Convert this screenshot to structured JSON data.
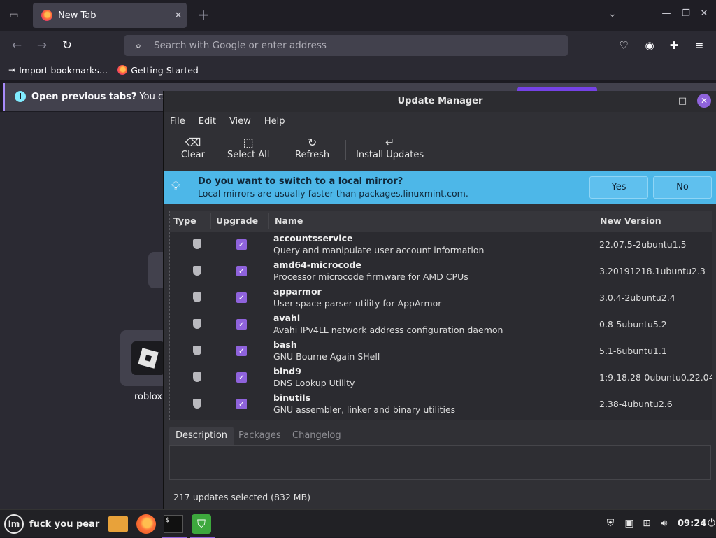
{
  "firefox": {
    "tab_title": "New Tab",
    "tab_close": "✕",
    "new_tab": "+",
    "url_placeholder": "Search with Google or enter address",
    "bookmarks": [
      {
        "label": "Import bookmarks…"
      },
      {
        "label": "Getting Started"
      }
    ],
    "notification": {
      "bold": "Open previous tabs?",
      "text": "You can re"
    },
    "shortcut_label": "roblox"
  },
  "update_manager": {
    "title": "Update Manager",
    "menu": [
      "File",
      "Edit",
      "View",
      "Help"
    ],
    "toolbar": {
      "clear": "Clear",
      "select_all": "Select All",
      "refresh": "Refresh",
      "install": "Install Updates"
    },
    "infobar": {
      "question": "Do you want to switch to a local mirror?",
      "subtext": "Local mirrors are usually faster than packages.linuxmint.com.",
      "yes": "Yes",
      "no": "No"
    },
    "columns": [
      "Type",
      "Upgrade",
      "Name",
      "New Version"
    ],
    "packages": [
      {
        "name": "accountsservice",
        "desc": "Query and manipulate user account information",
        "version": "22.07.5-2ubuntu1.5"
      },
      {
        "name": "amd64-microcode",
        "desc": "Processor microcode firmware for AMD CPUs",
        "version": "3.20191218.1ubuntu2.3"
      },
      {
        "name": "apparmor",
        "desc": "User-space parser utility for AppArmor",
        "version": "3.0.4-2ubuntu2.4"
      },
      {
        "name": "avahi",
        "desc": "Avahi IPv4LL network address configuration daemon",
        "version": "0.8-5ubuntu5.2"
      },
      {
        "name": "bash",
        "desc": "GNU Bourne Again SHell",
        "version": "5.1-6ubuntu1.1"
      },
      {
        "name": "bind9",
        "desc": "DNS Lookup Utility",
        "version": "1:9.18.28-0ubuntu0.22.04"
      },
      {
        "name": "binutils",
        "desc": "GNU assembler, linker and binary utilities",
        "version": "2.38-4ubuntu2.6"
      }
    ],
    "tabs": [
      "Description",
      "Packages",
      "Changelog"
    ],
    "status": "217 updates selected (832 MB)"
  },
  "taskbar": {
    "menu_label": "fuck you pear",
    "clock": "09:24"
  },
  "colors": {
    "accent": "#8f63dc",
    "infobar": "#4db7e8",
    "firefox_bg": "#2b2a33"
  }
}
